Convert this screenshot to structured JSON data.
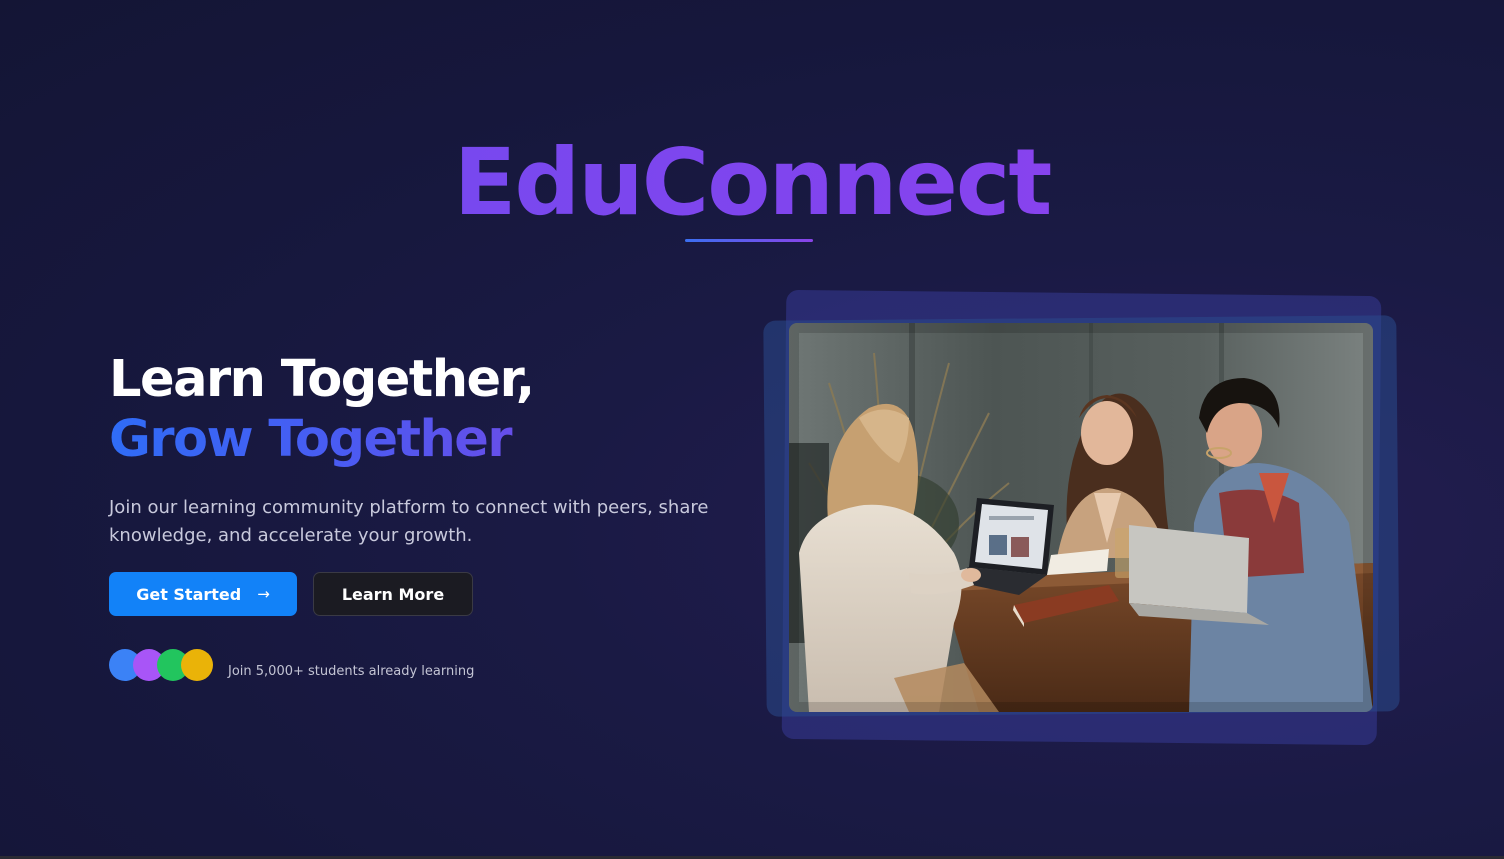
{
  "brand": {
    "name": "EduConnect"
  },
  "hero": {
    "headline_line1": "Learn Together,",
    "headline_line2": "Grow Together",
    "subtitle": "Join our learning community platform to connect with peers, share knowledge, and accelerate your growth.",
    "primary_button": {
      "label": "Get Started",
      "icon": "arrow-right-icon"
    },
    "secondary_button": {
      "label": "Learn More"
    },
    "social_proof": {
      "text": "Join 5,000+ students already learning",
      "avatar_colors": [
        "#3b82f6",
        "#a855f7",
        "#22c55e",
        "#eab308"
      ]
    },
    "image": {
      "alt": "students-studying-together-photo"
    }
  },
  "colors": {
    "accent_blue": "#1282f8",
    "brand_purple": "#7f45ee",
    "background": "#16173c"
  }
}
